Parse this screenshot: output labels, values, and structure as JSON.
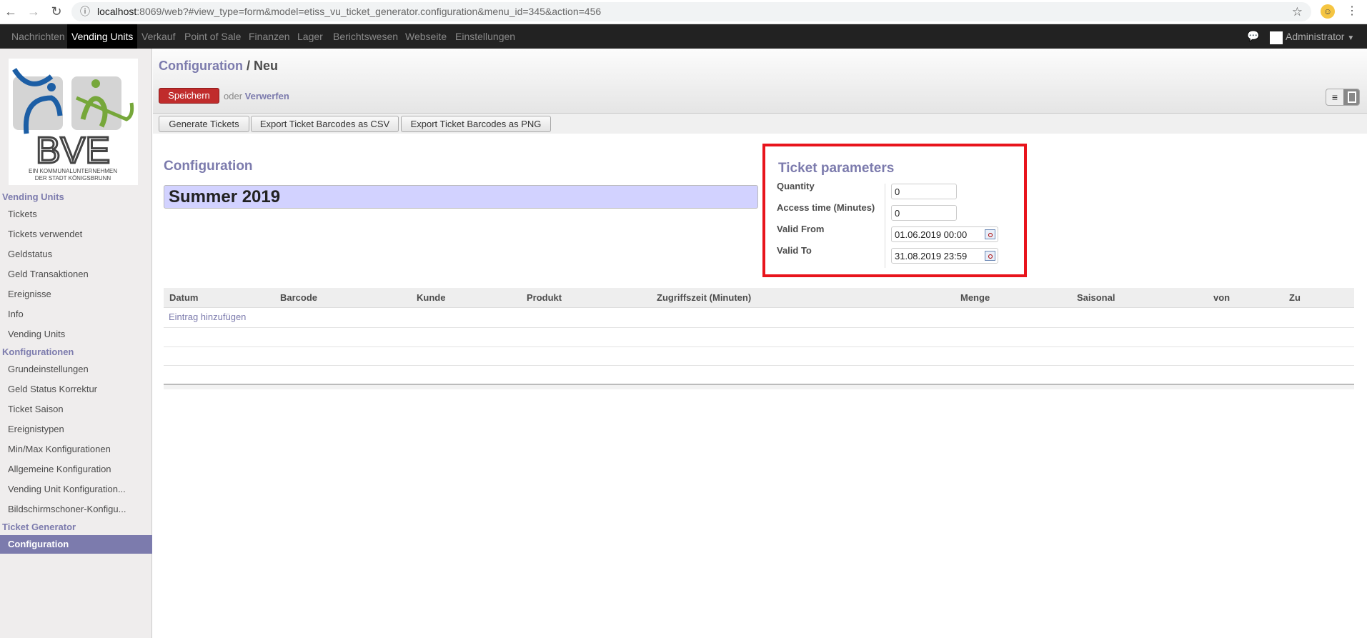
{
  "browser": {
    "url_host": "localhost",
    "url_rest": ":8069/web?#view_type=form&model=etiss_vu_ticket_generator.configuration&menu_id=345&action=456",
    "icons": [
      "back-icon",
      "forward-icon",
      "reload-icon",
      "info-icon",
      "star-icon",
      "profile-icon",
      "menu-dots-icon"
    ]
  },
  "topnav": {
    "items": [
      "Nachrichten",
      "Vending Units",
      "Verkauf",
      "Point of Sale",
      "Finanzen",
      "Lager",
      "Berichtswesen",
      "Webseite",
      "Einstellungen"
    ],
    "active": "Vending Units",
    "user": "Administrator"
  },
  "logo": {
    "text": "BVE",
    "line1": "EIN KOMMUNALUNTERNEHMEN",
    "line2": "DER STADT KÖNIGSBRUNN"
  },
  "sidebar": {
    "sections": [
      {
        "title": "Vending Units",
        "items": [
          "Tickets",
          "Tickets verwendet",
          "Geldstatus",
          "Geld Transaktionen",
          "Ereignisse",
          "Info",
          "Vending Units"
        ]
      },
      {
        "title": "Konfigurationen",
        "items": [
          "Grundeinstellungen",
          "Geld Status Korrektur",
          "Ticket Saison",
          "Ereignistypen",
          "Min/Max Konfigurationen",
          "Allgemeine Konfiguration",
          "Vending Unit Konfiguration...",
          "Bildschirmschoner-Konfigu..."
        ]
      },
      {
        "title": "Ticket Generator",
        "items": [
          "Configuration"
        ]
      }
    ],
    "active": "Configuration"
  },
  "header": {
    "crumb_parent": "Configuration",
    "crumb_sep": " / ",
    "crumb_current": "Neu",
    "save": "Speichern",
    "or": "oder ",
    "discard": "Verwerfen"
  },
  "toolbar": {
    "buttons": [
      "Generate Tickets",
      "Export Ticket Barcodes as CSV",
      "Export Ticket Barcodes as PNG"
    ]
  },
  "form": {
    "label": "Configuration",
    "name": "Summer 2019",
    "ticket_params": {
      "title": "Ticket parameters",
      "fields": [
        {
          "label": "Quantity",
          "value": "0"
        },
        {
          "label": "Access time (Minutes)",
          "value": "0"
        },
        {
          "label": "Valid From",
          "value": "01.06.2019 00:00"
        },
        {
          "label": "Valid To",
          "value": "31.08.2019 23:59"
        }
      ]
    },
    "highlight_color": "#e8141c"
  },
  "table": {
    "columns": [
      "Datum",
      "Barcode",
      "Kunde",
      "Produkt",
      "Zugriffszeit (Minuten)",
      "Menge",
      "Saisonal",
      "von",
      "Zu"
    ],
    "add_label": "Eintrag hinzufügen"
  },
  "colors": {
    "accent": "#7c7bad",
    "save": "#c02c2c",
    "name_field": "#d2d2ff"
  }
}
